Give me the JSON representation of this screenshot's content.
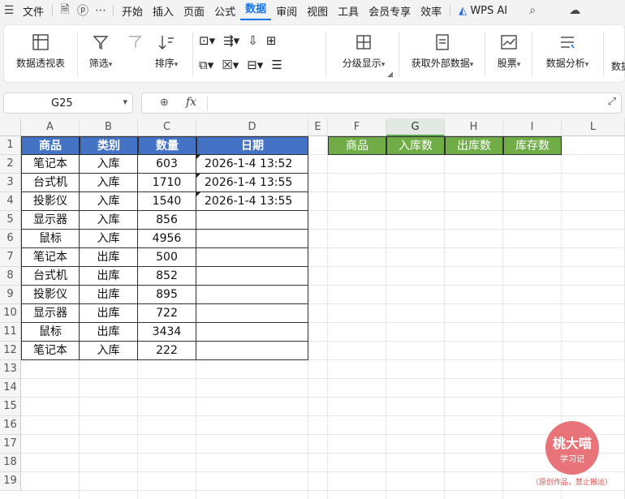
{
  "menu": {
    "file": "文件",
    "tabs": [
      "开始",
      "插入",
      "页面",
      "公式",
      "数据",
      "审阅",
      "视图",
      "工具",
      "会员专享",
      "效率"
    ],
    "active_tab": "数据",
    "wps_ai": "WPS AI"
  },
  "ribbon": {
    "pivot": "数据透视表",
    "filter": "筛选",
    "sort": "排序",
    "group": "分级显示",
    "external": "获取外部数据",
    "stocks": "股票",
    "analysis": "数据分析",
    "cut_off": "数据"
  },
  "formula_bar": {
    "name_box": "G25",
    "fx": "fx",
    "formula": ""
  },
  "columns": [
    "A",
    "B",
    "C",
    "D",
    "E",
    "F",
    "G",
    "H",
    "I",
    "L"
  ],
  "selected_column": "G",
  "rows": [
    "1",
    "2",
    "3",
    "4",
    "5",
    "6",
    "7",
    "8",
    "9",
    "10",
    "11",
    "12",
    "13",
    "14",
    "15",
    "16",
    "17",
    "18",
    "19"
  ],
  "table": {
    "headers": [
      "商品",
      "类别",
      "数量",
      "日期"
    ],
    "rows": [
      [
        "笔记本",
        "入库",
        "603",
        "2026-1-4 13:52"
      ],
      [
        "台式机",
        "入库",
        "1710",
        "2026-1-4 13:55"
      ],
      [
        "投影仪",
        "入库",
        "1540",
        "2026-1-4 13:55"
      ],
      [
        "显示器",
        "入库",
        "856",
        ""
      ],
      [
        "鼠标",
        "入库",
        "4956",
        ""
      ],
      [
        "笔记本",
        "出库",
        "500",
        ""
      ],
      [
        "台式机",
        "出库",
        "852",
        ""
      ],
      [
        "投影仪",
        "出库",
        "895",
        ""
      ],
      [
        "显示器",
        "出库",
        "722",
        ""
      ],
      [
        "鼠标",
        "出库",
        "3434",
        ""
      ],
      [
        "笔记本",
        "入库",
        "222",
        ""
      ]
    ]
  },
  "summary_headers": [
    "商品",
    "入库数",
    "出库数",
    "库存数"
  ],
  "watermark": {
    "title": "桃大喵",
    "subtitle": "学习记",
    "note": "（原创作品，禁止搬运）"
  },
  "colors": {
    "header_blue": "#4472c4",
    "header_green": "#70ad47",
    "accent": "#1a73e8"
  }
}
